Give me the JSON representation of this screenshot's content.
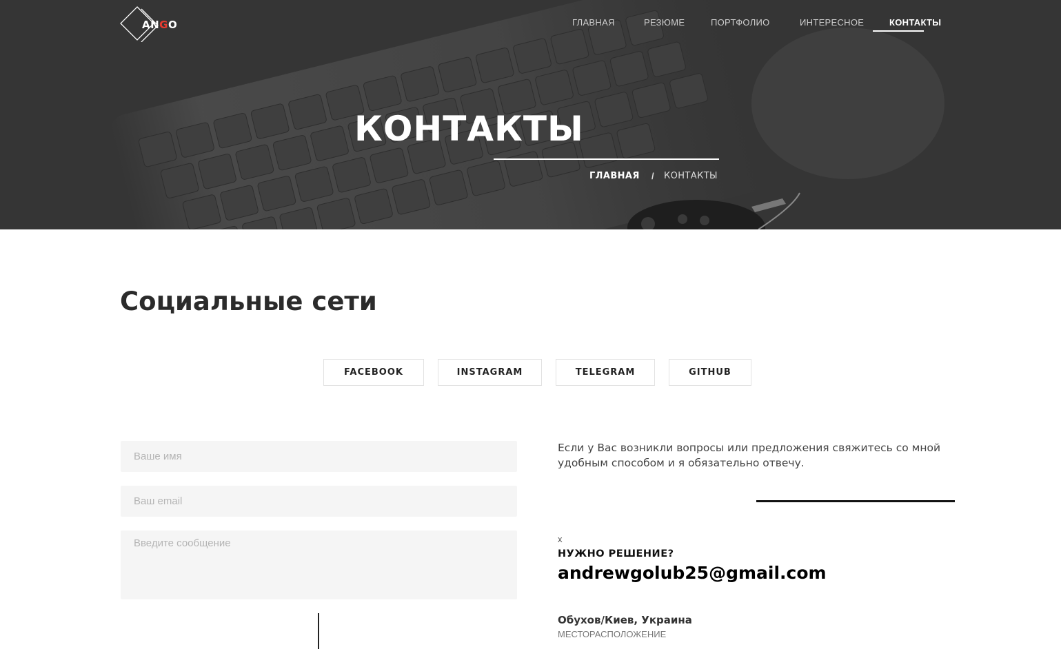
{
  "logo": {
    "text_main": "AN",
    "text_accent": "G",
    "text_end": "O",
    "icon": "diamond-logo-icon"
  },
  "nav": {
    "items": [
      {
        "label": "ГЛАВНАЯ"
      },
      {
        "label": "РЕЗЮМЕ"
      },
      {
        "label": "ПОРТФОЛИО"
      },
      {
        "label": "ИНТЕРЕСНОЕ"
      },
      {
        "label": "КОНТАКТЫ",
        "active": true
      }
    ]
  },
  "hero": {
    "title": "КОНТАКТЫ",
    "breadcrumb": {
      "home": "ГЛАВНАЯ",
      "separator": "/",
      "current": "КОНТАКТЫ"
    },
    "background": "keyboard-photo"
  },
  "social": {
    "title": "Социальные сети",
    "buttons": [
      "FACEBOOK",
      "INSTAGRAM",
      "TELEGRAM",
      "GITHUB"
    ]
  },
  "form": {
    "name_placeholder": "Ваше имя",
    "email_placeholder": "Ваш email",
    "message_placeholder": "Введите сообщение"
  },
  "info": {
    "text": "Если у Вас возникли вопросы или предложения свяжитесь со мной удобным способом и я обязательно отвечу.",
    "close": "x",
    "need_title": "НУЖНО РЕШЕНИЕ?",
    "email": "andrewgolub25@gmail.com",
    "location": "Обухов/Киев, Украина",
    "location_label": "МЕСТОРАСПОЛОЖЕНИЕ"
  },
  "colors": {
    "accent": "#e83a2f",
    "hero_bg": "#353535",
    "field_bg": "#f5f5f5"
  }
}
